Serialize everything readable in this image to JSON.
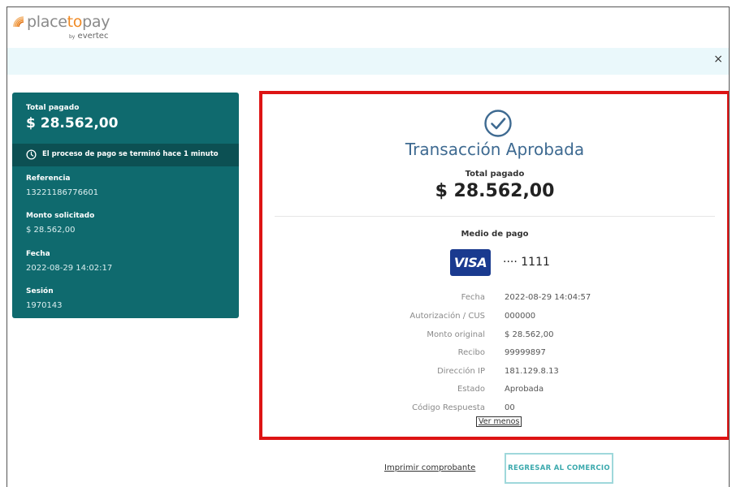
{
  "header": {
    "logo_pre": "place",
    "logo_to": "to",
    "logo_post": "pay",
    "logo_by": "by",
    "logo_sub": "evertec",
    "close_label": "×"
  },
  "summary": {
    "total_label": "Total pagado",
    "total_value": "$ 28.562,00",
    "status_text": "El proceso de pago se terminó hace 1 minuto",
    "referencia_label": "Referencia",
    "referencia_value": "13221186776601",
    "monto_label": "Monto solicitado",
    "monto_value": "$ 28.562,00",
    "fecha_label": "Fecha",
    "fecha_value": "2022-08-29 14:02:17",
    "sesion_label": "Sesión",
    "sesion_value": "1970143"
  },
  "result": {
    "title": "Transacción Aprobada",
    "total_label": "Total pagado",
    "total_value": "$ 28.562,00",
    "payment_method_label": "Medio de pago",
    "card_brand": "VISA",
    "card_number": "···· 1111",
    "details": [
      {
        "label": "Fecha",
        "value": "2022-08-29 14:04:57"
      },
      {
        "label": "Autorización / CUS",
        "value": "000000"
      },
      {
        "label": "Monto original",
        "value": "$ 28.562,00"
      },
      {
        "label": "Recibo",
        "value": "99999897"
      },
      {
        "label": "Dirección IP",
        "value": "181.129.8.13"
      },
      {
        "label": "Estado",
        "value": "Aprobada"
      },
      {
        "label": "Código Respuesta",
        "value": "00"
      }
    ],
    "toggle_label": "Ver menos"
  },
  "actions": {
    "print_label": "Imprimir comprobante",
    "return_label": "REGRESAR AL COMERCIO"
  },
  "colors": {
    "sidebar": "#0f6a6e",
    "sidebar_bar": "#0c5053",
    "highlight_border": "#dd1414",
    "title_blue": "#3e6a91",
    "visa_blue": "#1a3a8f",
    "brand_orange": "#f08a24",
    "banner": "#eaf8fb"
  },
  "icons": {
    "close": "close-icon",
    "clock": "clock-icon",
    "approved": "check-circle-icon",
    "card": "visa-icon"
  }
}
